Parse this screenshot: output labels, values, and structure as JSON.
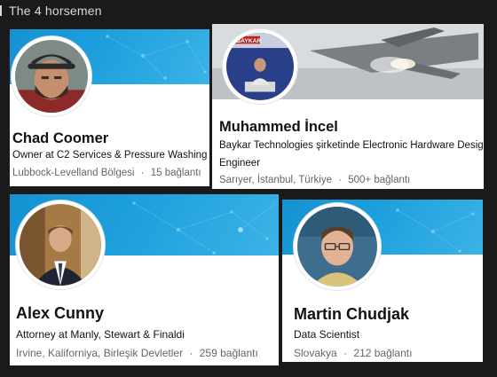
{
  "post": {
    "title": "The 4 horsemen"
  },
  "profiles": [
    {
      "name": "Chad Coomer",
      "headline": "Owner at C2 Services & Pressure Washing",
      "location": "Lubbock-Levelland Bölgesi",
      "connections": "15 bağlantı"
    },
    {
      "name": "Muhammed İncel",
      "headline": "Baykar Technologies şirketinde Electronic Hardware Design",
      "headline_line2": "Engineer",
      "location": "Sarıyer, İstanbul, Türkiye",
      "connections": "500+ bağlantı",
      "banner_logo": "BAYKAR"
    },
    {
      "name": "Alex Cunny",
      "headline": "Attorney at Manly, Stewart & Finaldi",
      "location": "Irvine, Kaliforniya, Birleşik Devletler",
      "connections": "259 bağlantı"
    },
    {
      "name": "Martin Chudjak",
      "headline": "Data Scientist",
      "location": "Slovakya",
      "connections": "212 bağlantı"
    }
  ],
  "separator": "·",
  "colors": {
    "banner_blue": "#1a98d8",
    "page_bg": "#1a1a1b",
    "card_bg": "#ffffff"
  }
}
